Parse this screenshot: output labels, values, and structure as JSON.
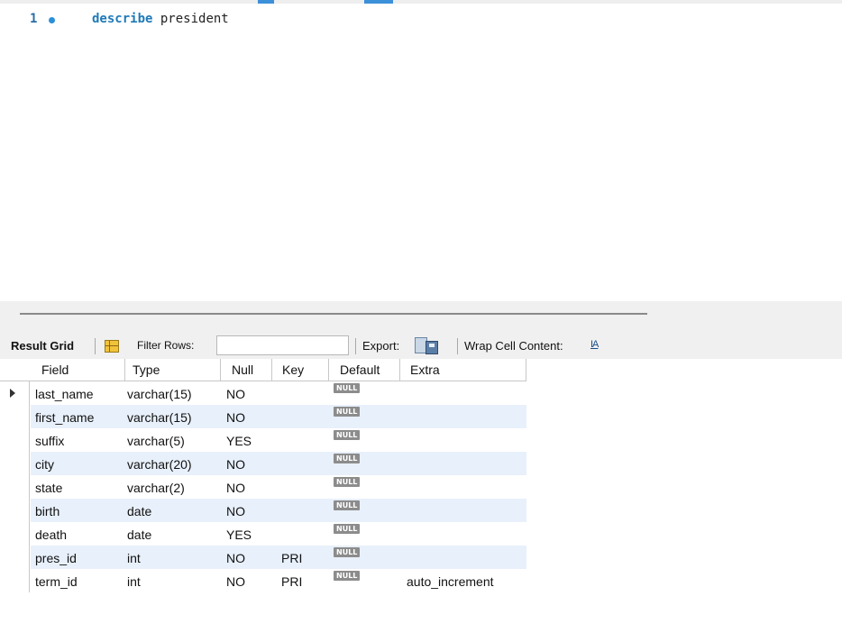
{
  "editor": {
    "line_number": "1",
    "keyword": "describe",
    "statement_rest": " president"
  },
  "toolbar": {
    "result_grid_label": "Result Grid",
    "filter_rows_label": "Filter Rows:",
    "filter_rows_value": "",
    "export_label": "Export:",
    "wrap_cell_label": "Wrap Cell Content:",
    "wrap_icon_glyph": "IA"
  },
  "grid": {
    "columns": [
      "Field",
      "Type",
      "Null",
      "Key",
      "Default",
      "Extra"
    ],
    "null_label": "NULL",
    "rows": [
      {
        "field": "last_name",
        "type": "varchar(15)",
        "null": "NO",
        "key": "",
        "default": "NULL",
        "extra": ""
      },
      {
        "field": "first_name",
        "type": "varchar(15)",
        "null": "NO",
        "key": "",
        "default": "NULL",
        "extra": ""
      },
      {
        "field": "suffix",
        "type": "varchar(5)",
        "null": "YES",
        "key": "",
        "default": "NULL",
        "extra": ""
      },
      {
        "field": "city",
        "type": "varchar(20)",
        "null": "NO",
        "key": "",
        "default": "NULL",
        "extra": ""
      },
      {
        "field": "state",
        "type": "varchar(2)",
        "null": "NO",
        "key": "",
        "default": "NULL",
        "extra": ""
      },
      {
        "field": "birth",
        "type": "date",
        "null": "NO",
        "key": "",
        "default": "NULL",
        "extra": ""
      },
      {
        "field": "death",
        "type": "date",
        "null": "YES",
        "key": "",
        "default": "NULL",
        "extra": ""
      },
      {
        "field": "pres_id",
        "type": "int",
        "null": "NO",
        "key": "PRI",
        "default": "NULL",
        "extra": ""
      },
      {
        "field": "term_id",
        "type": "int",
        "null": "NO",
        "key": "PRI",
        "default": "NULL",
        "extra": "auto_increment"
      }
    ]
  },
  "colors": {
    "accent": "#3c8fd9",
    "alt_row": "#e8f0fb",
    "keyword": "#1f7ab8"
  }
}
